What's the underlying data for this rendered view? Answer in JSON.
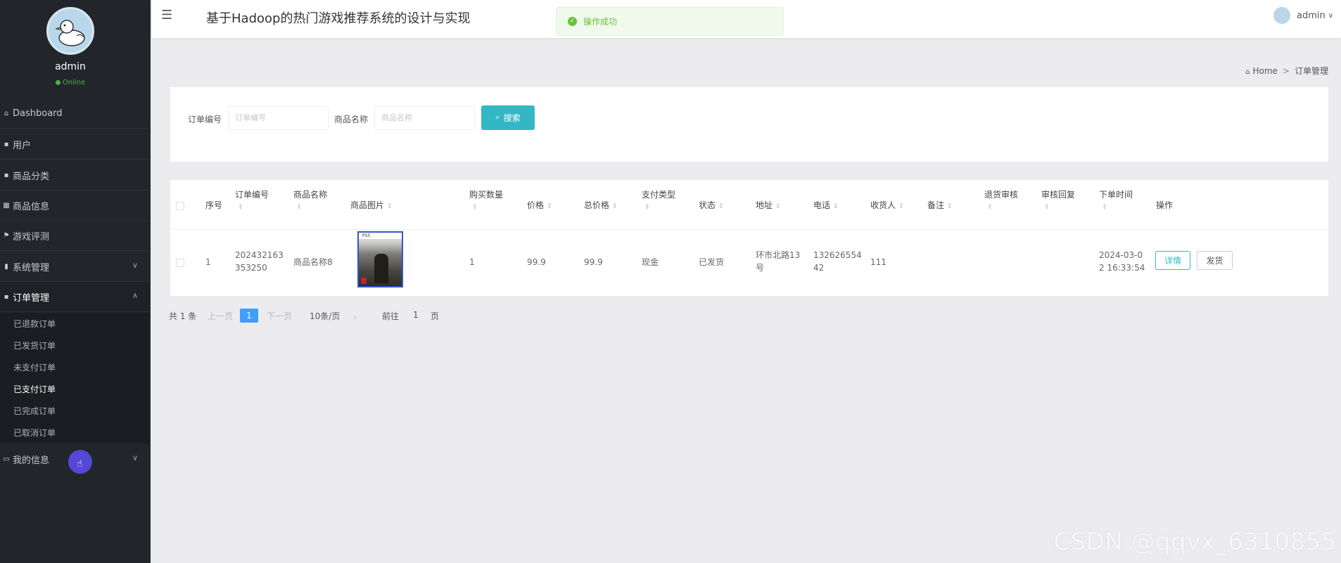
{
  "sidebar": {
    "username": "admin",
    "status": "Online",
    "items": [
      {
        "label": "Dashboard",
        "icon": "home-icon"
      },
      {
        "label": "用户",
        "icon": "grid-icon"
      },
      {
        "label": "商品分类",
        "icon": "grid-icon"
      },
      {
        "label": "商品信息",
        "icon": "table-icon"
      },
      {
        "label": "游戏评测",
        "icon": "flag-icon"
      },
      {
        "label": "系统管理",
        "icon": "bar-chart-icon"
      },
      {
        "label": "订单管理",
        "icon": "grid-icon"
      },
      {
        "label": "我的信息",
        "icon": "card-icon"
      }
    ],
    "order_sub": [
      "已退款订单",
      "已发货订单",
      "未支付订单",
      "已支付订单",
      "已完成订单",
      "已取消订单"
    ]
  },
  "header": {
    "title": "基于Hadoop的热门游戏推荐系统的设计与实现",
    "user": "admin",
    "toast": "操作成功"
  },
  "breadcrumb": {
    "home": "Home",
    "sep": ">",
    "current": "订单管理"
  },
  "search": {
    "order_no_label": "订单编号",
    "order_no_placeholder": "订单编号",
    "name_label": "商品名称",
    "name_placeholder": "商品名称",
    "button": "搜索"
  },
  "table": {
    "headers": {
      "index": "序号",
      "order_no": "订单编号",
      "name": "商品名称",
      "image": "商品图片",
      "qty": "购买数量",
      "price": "价格",
      "total": "总价格",
      "pay_type": "支付类型",
      "status": "状态",
      "address": "地址",
      "phone": "电话",
      "receiver": "收货人",
      "remark": "备注",
      "refund_audit": "退货审核",
      "audit_reply": "审核回复",
      "order_time": "下单时间",
      "actions": "操作"
    },
    "row": {
      "index": "1",
      "order_no_1": "202432163",
      "order_no_2": "353250",
      "name": "商品名称8",
      "image_label": "PS5",
      "qty": "1",
      "price": "99.9",
      "total": "99.9",
      "pay_type": "现金",
      "status": "已发货",
      "address_1": "环市北路13",
      "address_2": "号",
      "phone_1": "132626554",
      "phone_2": "42",
      "receiver": "111",
      "time_1": "2024-03-0",
      "time_2": "2 16:33:54",
      "detail_btn": "详情",
      "ship_btn": "发货"
    }
  },
  "pagination": {
    "total": "共 1 条",
    "prev": "上一页",
    "current": "1",
    "next": "下一页",
    "size": "10条/页",
    "goto": "前往",
    "page": "1",
    "page_unit": "页"
  },
  "watermark": "CSDN @qqvx_6310855"
}
